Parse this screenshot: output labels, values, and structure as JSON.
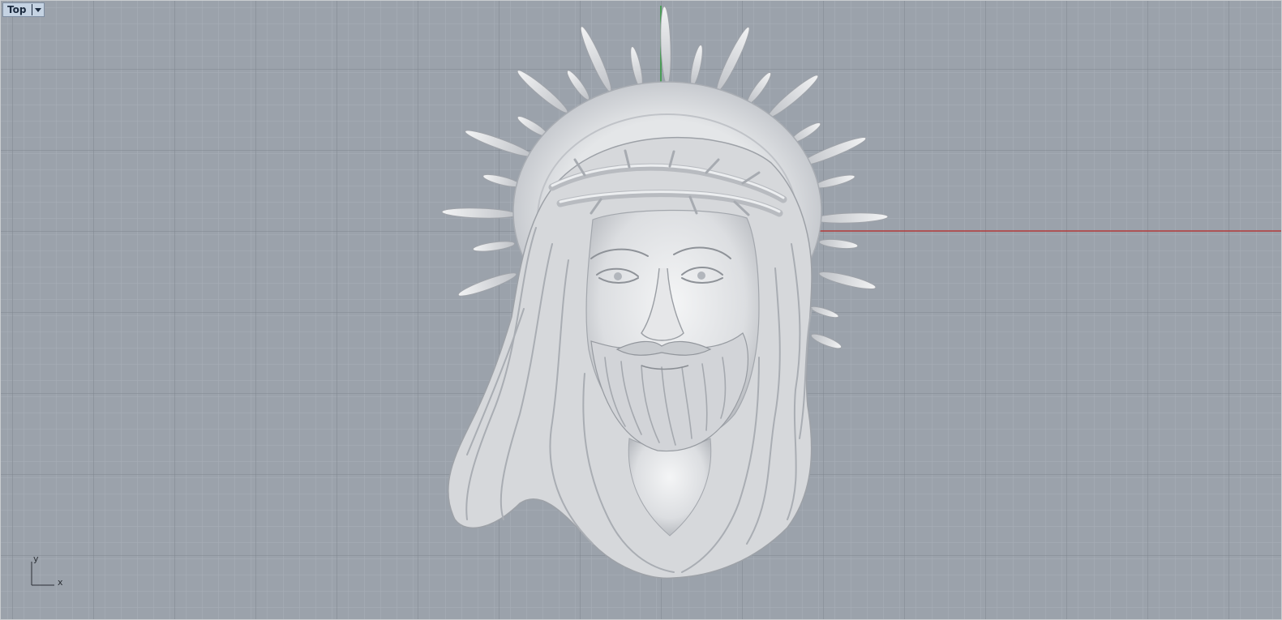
{
  "viewport": {
    "name": "Top",
    "dropdown_icon": "chevron-down-icon"
  },
  "axes": {
    "y_label": "y",
    "x_label": "x",
    "x_axis_color": "#b33a3a",
    "y_axis_color": "#2f9a3a"
  },
  "colors": {
    "background": "#9ba2ab",
    "grid_minor": "#a5acb4",
    "grid_major": "#7e858e",
    "model": "#e9eaec"
  }
}
